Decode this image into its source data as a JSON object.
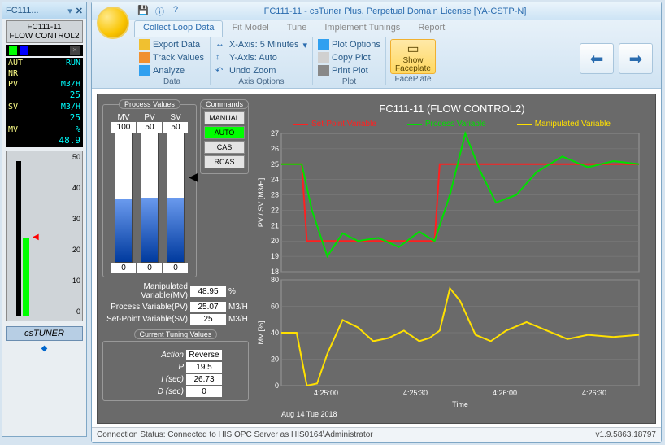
{
  "left_panel": {
    "tab_title": "FC111...",
    "tag": "FC111-11",
    "desc": "FLOW CONTROL2",
    "mode_l": "AUT",
    "mode_r": "RUN",
    "alarm": "NR",
    "rows": [
      {
        "label": "PV",
        "unit": "M3/H",
        "value": "25"
      },
      {
        "label": "SV",
        "unit": "M3/H",
        "value": "25"
      },
      {
        "label": "MV",
        "unit": "%",
        "value": "48.9"
      }
    ],
    "scale": [
      "50",
      "40",
      "30",
      "20",
      "10",
      "0"
    ],
    "footer": "csTUNER"
  },
  "main": {
    "title": "FC111-11 - csTuner Plus, Perpetual Domain License [YA-CSTP-N]",
    "tabs": [
      "Collect Loop Data",
      "Fit Model",
      "Tune",
      "Implement Tunings",
      "Report"
    ],
    "active_tab": 0,
    "groups": {
      "data": {
        "label": "Data",
        "items": [
          "Export Data",
          "Track Values",
          "Analyze"
        ]
      },
      "axis": {
        "label": "Axis Options",
        "items": [
          "X-Axis: 5 Minutes",
          "Y-Axis: Auto",
          "Undo Zoom"
        ]
      },
      "plot": {
        "label": "Plot",
        "items": [
          "Plot Options",
          "Copy Plot",
          "Print Plot"
        ]
      },
      "faceplate": {
        "label": "FacePlate",
        "big": "Show Faceplate"
      }
    }
  },
  "process_values": {
    "title": "Process Values",
    "bars": [
      {
        "name": "MV",
        "top": "100",
        "bot": "0",
        "pct": 48.95
      },
      {
        "name": "PV",
        "top": "50",
        "bot": "0",
        "pct": 50.14
      },
      {
        "name": "SV",
        "top": "50",
        "bot": "0",
        "pct": 50
      }
    ],
    "readouts": [
      {
        "name": "Manipulated Variable(MV)",
        "value": "48.95",
        "unit": "%"
      },
      {
        "name": "Process Variable(PV)",
        "value": "25.07",
        "unit": "M3/H"
      },
      {
        "name": "Set-Point Variable(SV)",
        "value": "25",
        "unit": "M3/H"
      }
    ]
  },
  "commands": {
    "title": "Commands",
    "items": [
      "MANUAL",
      "AUTO",
      "CAS",
      "RCAS"
    ],
    "active": 1
  },
  "tuning": {
    "title": "Current Tuning Values",
    "rows": [
      {
        "name": "Action",
        "value": "Reverse"
      },
      {
        "name": "P",
        "value": "19.5"
      },
      {
        "name": "I (sec)",
        "value": "26.73"
      },
      {
        "name": "D (sec)",
        "value": "0"
      }
    ]
  },
  "chart": {
    "title": "FC111-11 (FLOW CONTROL2)",
    "legend": [
      {
        "name": "Set-Point Variable",
        "color": "#ff2020"
      },
      {
        "name": "Process Variable",
        "color": "#00e000"
      },
      {
        "name": "Manipulated Variable",
        "color": "#ffe000"
      }
    ],
    "y1_label": "PV / SV [M3/H]",
    "y2_label": "MV [%]",
    "y1_ticks": [
      "27",
      "26",
      "25",
      "24",
      "23",
      "22",
      "21",
      "20",
      "19",
      "18"
    ],
    "y2_ticks": [
      "80",
      "60",
      "40",
      "20",
      "0"
    ],
    "x_ticks": [
      "4:25:00",
      "4:25:30",
      "4:26:00",
      "4:26:30"
    ],
    "x_label": "Time",
    "date": "Aug 14 Tue 2018"
  },
  "chart_data": {
    "type": "line",
    "x_range": [
      0,
      140
    ],
    "series": [
      {
        "name": "Set-Point Variable",
        "axis": "y1",
        "color": "#ff2020",
        "points": [
          [
            0,
            25
          ],
          [
            8,
            25
          ],
          [
            10,
            20
          ],
          [
            60,
            20
          ],
          [
            62,
            25
          ],
          [
            140,
            25
          ]
        ]
      },
      {
        "name": "Process Variable",
        "axis": "y1",
        "color": "#00e000",
        "points": [
          [
            0,
            25
          ],
          [
            8,
            25
          ],
          [
            12,
            22
          ],
          [
            18,
            19
          ],
          [
            24,
            20.5
          ],
          [
            30,
            20
          ],
          [
            38,
            20.2
          ],
          [
            46,
            19.6
          ],
          [
            54,
            20.6
          ],
          [
            60,
            20
          ],
          [
            66,
            23
          ],
          [
            72,
            27
          ],
          [
            78,
            24.5
          ],
          [
            84,
            22.5
          ],
          [
            92,
            23
          ],
          [
            100,
            24.5
          ],
          [
            110,
            25.5
          ],
          [
            120,
            24.8
          ],
          [
            130,
            25.2
          ],
          [
            140,
            25
          ]
        ]
      },
      {
        "name": "Manipulated Variable",
        "axis": "y2",
        "color": "#ffe000",
        "points": [
          [
            0,
            50
          ],
          [
            6,
            50
          ],
          [
            10,
            0
          ],
          [
            14,
            2
          ],
          [
            18,
            30
          ],
          [
            24,
            62
          ],
          [
            30,
            55
          ],
          [
            36,
            42
          ],
          [
            42,
            45
          ],
          [
            48,
            52
          ],
          [
            54,
            42
          ],
          [
            58,
            45
          ],
          [
            62,
            52
          ],
          [
            66,
            92
          ],
          [
            70,
            80
          ],
          [
            76,
            48
          ],
          [
            82,
            42
          ],
          [
            88,
            52
          ],
          [
            96,
            60
          ],
          [
            104,
            52
          ],
          [
            112,
            44
          ],
          [
            120,
            48
          ],
          [
            130,
            46
          ],
          [
            140,
            48
          ]
        ]
      }
    ],
    "y1_range": [
      18,
      27
    ],
    "y2_range": [
      0,
      100
    ]
  },
  "status": {
    "text": "Connection Status: Connected to HIS OPC Server as HIS0164\\Administrator",
    "version": "v1.9.5863.18797"
  }
}
